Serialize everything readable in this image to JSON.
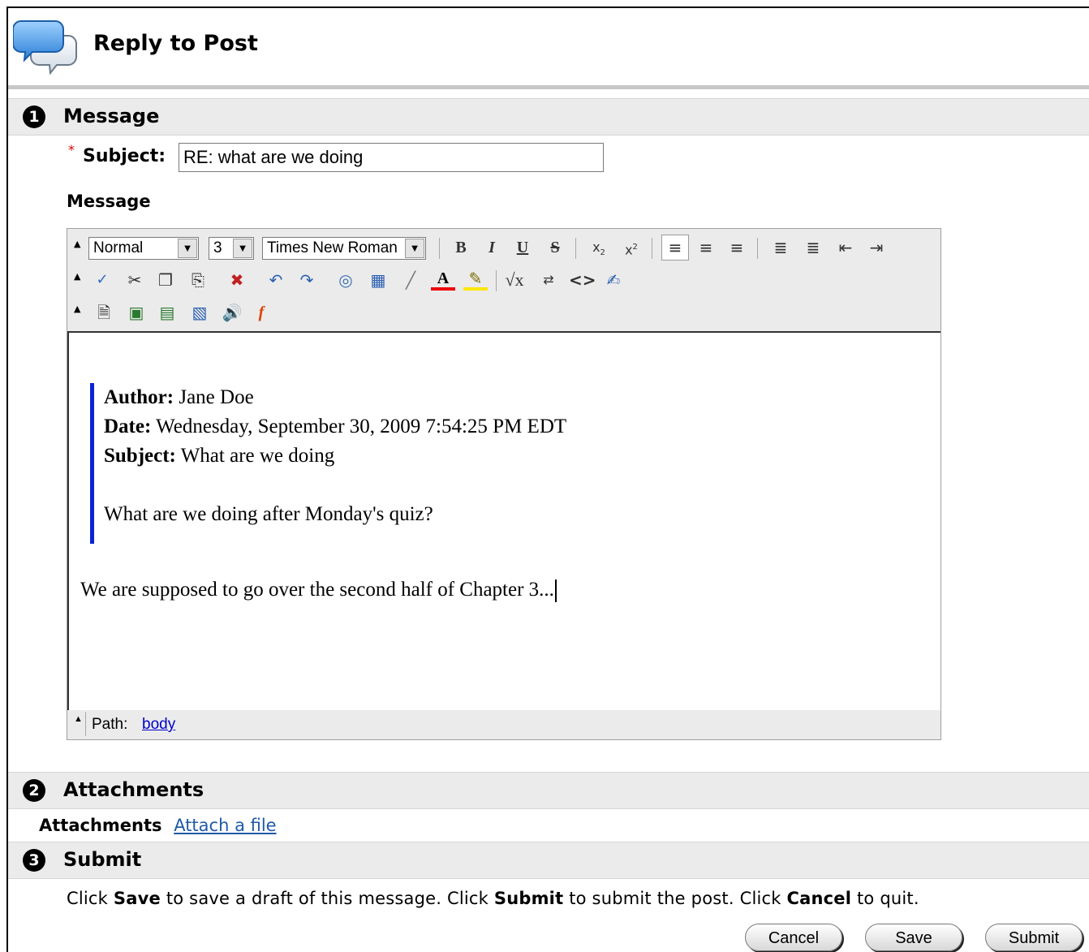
{
  "header": {
    "title": "Reply to Post",
    "icon": "speech-bubbles-icon"
  },
  "sections": {
    "message": {
      "num": "1",
      "label": "Message"
    },
    "attachments": {
      "num": "2",
      "label": "Attachments"
    },
    "submit": {
      "num": "3",
      "label": "Submit"
    }
  },
  "form": {
    "required_mark": "*",
    "subject_label": "Subject:",
    "subject_value": "RE: what are we doing",
    "message_label": "Message"
  },
  "toolbar": {
    "format_select": "Normal",
    "size_select": "3",
    "font_select": "Times New Roman"
  },
  "editor": {
    "quote": {
      "author_label": "Author:",
      "author_value": "Jane Doe",
      "date_label": "Date:",
      "date_value": "Wednesday, September 30, 2009 7:54:25 PM EDT",
      "subject_label": "Subject:",
      "subject_value": "What are we doing",
      "body": "What are we doing after Monday's quiz?"
    },
    "reply_text": "We are supposed to go over the second half of Chapter 3...",
    "path_label": "Path:",
    "path_link": "body",
    "quote_bar_color": "#0a23d6"
  },
  "attachments": {
    "label": "Attachments",
    "link": "Attach a file"
  },
  "submit_text": {
    "p1": "Click ",
    "save": "Save",
    "p2": " to save a draft of this message. Click ",
    "submit": "Submit",
    "p3": " to submit the post. Click ",
    "cancel": "Cancel",
    "p4": " to quit."
  },
  "buttons": {
    "cancel": "Cancel",
    "save": "Save",
    "submit": "Submit"
  }
}
